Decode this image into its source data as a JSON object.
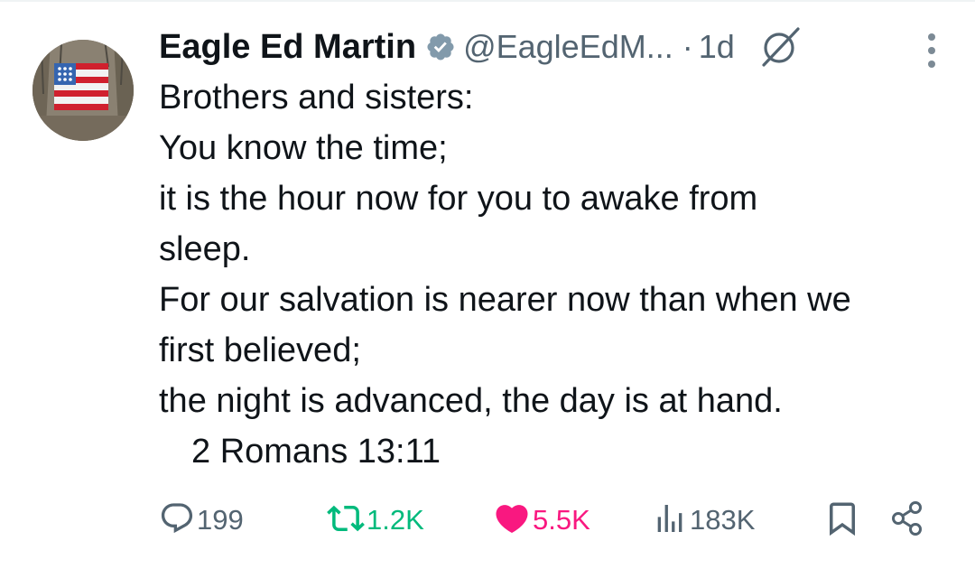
{
  "tweet": {
    "author_name": "Eagle Ed Martin",
    "handle": "@EagleEdM...",
    "separator": "·",
    "time": "1d",
    "lines": [
      "Brothers and sisters:",
      "You know the time;",
      "it is the hour now for you to awake from",
      "sleep.",
      "For our salvation is nearer now than when we",
      "first believed;",
      "the night is advanced, the day is at hand."
    ],
    "reference": "2 Romans 13:11"
  },
  "actions": {
    "replies": "199",
    "reposts": "1.2K",
    "likes": "5.5K",
    "views": "183K"
  },
  "icons": {
    "verified": "verified-badge-icon",
    "grok": "grok-icon",
    "more": "more-options-icon",
    "reply": "reply-icon",
    "repost": "repost-icon",
    "like": "heart-icon",
    "views": "views-icon",
    "bookmark": "bookmark-icon",
    "share": "share-icon"
  },
  "colors": {
    "text": "#0f1419",
    "secondary": "#536471",
    "repost": "#00ba7c",
    "like": "#f91880",
    "verified": "#829aab"
  }
}
